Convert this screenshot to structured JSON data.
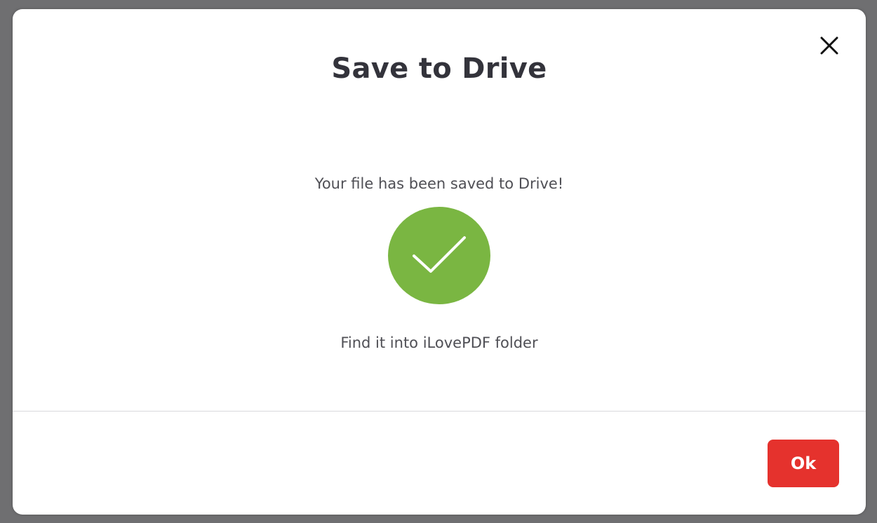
{
  "dialog": {
    "title": "Save to Drive",
    "message": "Your file has been saved to Drive!",
    "hint": "Find it into iLovePDF folder",
    "ok_label": "Ok",
    "close_icon": "close-icon",
    "success_icon": "checkmark-icon"
  },
  "colors": {
    "success": "#7ab642",
    "primary_button": "#e5322d",
    "title_text": "#33333b",
    "overlay": "#6f6f71"
  }
}
